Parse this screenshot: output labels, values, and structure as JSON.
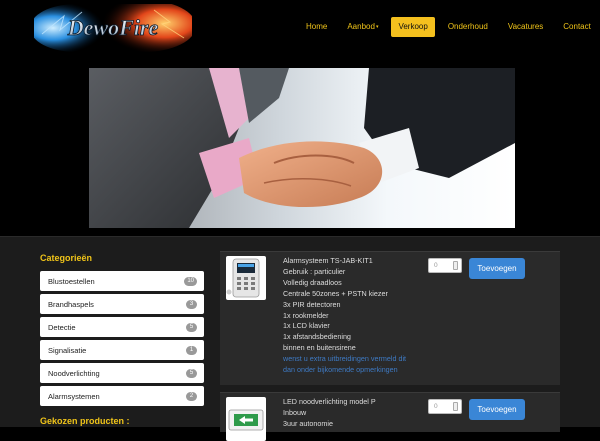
{
  "header": {
    "logo_text": "DewoFire",
    "nav": [
      {
        "label": "Home",
        "active": false,
        "dropdown": false
      },
      {
        "label": "Aanbod",
        "active": false,
        "dropdown": true
      },
      {
        "label": "Verkoop",
        "active": true,
        "dropdown": false
      },
      {
        "label": "Onderhoud",
        "active": false,
        "dropdown": false
      },
      {
        "label": "Vacatures",
        "active": false,
        "dropdown": false
      },
      {
        "label": "Contact",
        "active": false,
        "dropdown": false
      }
    ],
    "dropdown_caret": "▾"
  },
  "sidebar": {
    "title": "Categorieën",
    "items": [
      {
        "label": "Blustoestellen",
        "count": "10"
      },
      {
        "label": "Brandhaspels",
        "count": "3"
      },
      {
        "label": "Detectie",
        "count": "5"
      },
      {
        "label": "Signalisatie",
        "count": "1"
      },
      {
        "label": "Noodverlichting",
        "count": "5"
      },
      {
        "label": "Alarmsystemen",
        "count": "2"
      }
    ],
    "selected_title": "Gekozen producten :"
  },
  "products": [
    {
      "lines": [
        "Alarmsysteem TS-JAB-KIT1",
        "Gebruik : particulier",
        "Volledig draadloos",
        "Centrale 50zones + PSTN kiezer",
        "3x PIR detectoren",
        "1x rookmelder",
        "1x LCD klavier",
        "1x afstandsbediening",
        "binnen en buitensirene"
      ],
      "note": "wenst u extra uitbreidingen vermeld dit dan onder bijkomende opmerkingen",
      "quantity": "0",
      "button": "Toevoegen"
    },
    {
      "lines": [
        "LED noodverlichting model P",
        "Inbouw",
        "3uur autonomie"
      ],
      "note": "",
      "quantity": "0",
      "button": "Toevoegen"
    }
  ],
  "colors": {
    "accent": "#f0c419",
    "button": "#3a86d6",
    "link": "#3e7ac4"
  },
  "icons": {
    "thumb1": "alarm-panel-icon",
    "thumb2": "emergency-exit-sign-icon",
    "spinner": "number-spinner-icon"
  }
}
